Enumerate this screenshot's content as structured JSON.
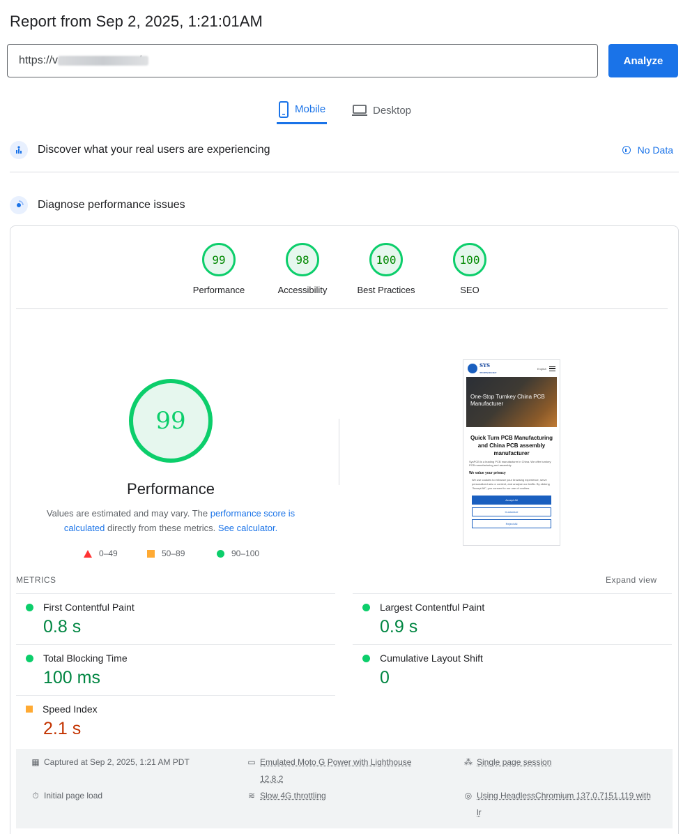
{
  "header": {
    "title": "Report from Sep 2, 2025, 1:21:01AM",
    "url_value": "https://v                    .om/",
    "analyze_label": "Analyze"
  },
  "tabs": [
    {
      "label": "Mobile",
      "active": true
    },
    {
      "label": "Desktop",
      "active": false
    }
  ],
  "field_data": {
    "label": "Discover what your real users are experiencing",
    "status": "No Data"
  },
  "lab_data": {
    "label": "Diagnose performance issues"
  },
  "categories": [
    {
      "label": "Performance",
      "score": "99"
    },
    {
      "label": "Accessibility",
      "score": "98"
    },
    {
      "label": "Best Practices",
      "score": "100"
    },
    {
      "label": "SEO",
      "score": "100"
    }
  ],
  "performance": {
    "score": "99",
    "title": "Performance",
    "desc_1": "Values are estimated and may vary. The ",
    "desc_link_1": "performance score is calculated",
    "desc_2": " directly from these metrics. ",
    "desc_link_2": "See calculator."
  },
  "legend": {
    "fail": "0–49",
    "average": "50–89",
    "pass": "90–100"
  },
  "screenshot": {
    "logo": "SYS",
    "logo_sub": "TECHNOLOGY",
    "lang": "English",
    "hero_text": "One-Stop Turnkey China PCB Manufacturer",
    "heading": "Quick Turn PCB Manufacturing and China PCB assembly manufacturer",
    "body": "SysPCB is a leading PCB manufacturer in China. We offer turnkey PCB manufacturing and assembly.",
    "privacy_title": "We value your privacy",
    "privacy_text": "We use cookies to enhance your browsing experience, serve personalized ads or content, and analyze our traffic. By clicking \"Accept All\", you consent to our use of cookies.",
    "btn_accept": "Accept All",
    "btn_customize": "Customize",
    "btn_reject": "Reject All"
  },
  "metrics": {
    "label": "METRICS",
    "expand": "Expand view",
    "items": [
      {
        "name": "First Contentful Paint",
        "value": "0.8 s",
        "rating": "pass"
      },
      {
        "name": "Largest Contentful Paint",
        "value": "0.9 s",
        "rating": "pass"
      },
      {
        "name": "Total Blocking Time",
        "value": "100 ms",
        "rating": "pass"
      },
      {
        "name": "Cumulative Layout Shift",
        "value": "0",
        "rating": "pass"
      },
      {
        "name": "Speed Index",
        "value": "2.1 s",
        "rating": "average"
      }
    ]
  },
  "footer": {
    "captured": "Captured at Sep 2, 2025, 1:21 AM PDT",
    "emulated": "Emulated Moto G Power with Lighthouse",
    "emulated_version": "12.8.2",
    "session": "Single page session",
    "initial_load": "Initial page load",
    "throttling": "Slow 4G throttling",
    "browser": "Using HeadlessChromium 137.0.7151.119 with",
    "browser_2": "lr"
  },
  "colors": {
    "accent": "#1a73e8",
    "pass": "#0cce6b",
    "average": "#ffaa33",
    "fail": "#ff3333"
  }
}
